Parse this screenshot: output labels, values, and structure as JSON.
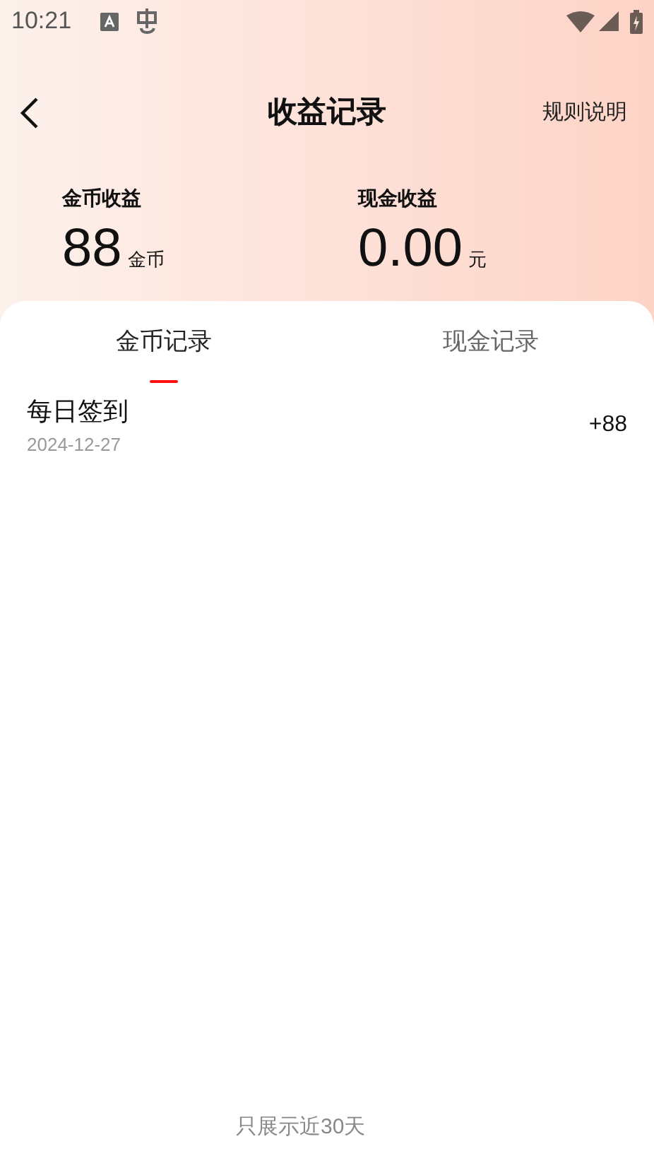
{
  "status_bar": {
    "time": "10:21"
  },
  "header": {
    "title": "收益记录",
    "action": "规则说明"
  },
  "stats": [
    {
      "label": "金币收益",
      "value": "88",
      "unit": "金币"
    },
    {
      "label": "现金收益",
      "value": "0.00",
      "unit": "元"
    }
  ],
  "tabs": [
    {
      "label": "金币记录",
      "selected": true
    },
    {
      "label": "现金记录",
      "selected": false
    }
  ],
  "records": [
    {
      "title": "每日签到",
      "date": "2024-12-27",
      "amount": "+88"
    }
  ],
  "footer": "只展示近30天"
}
